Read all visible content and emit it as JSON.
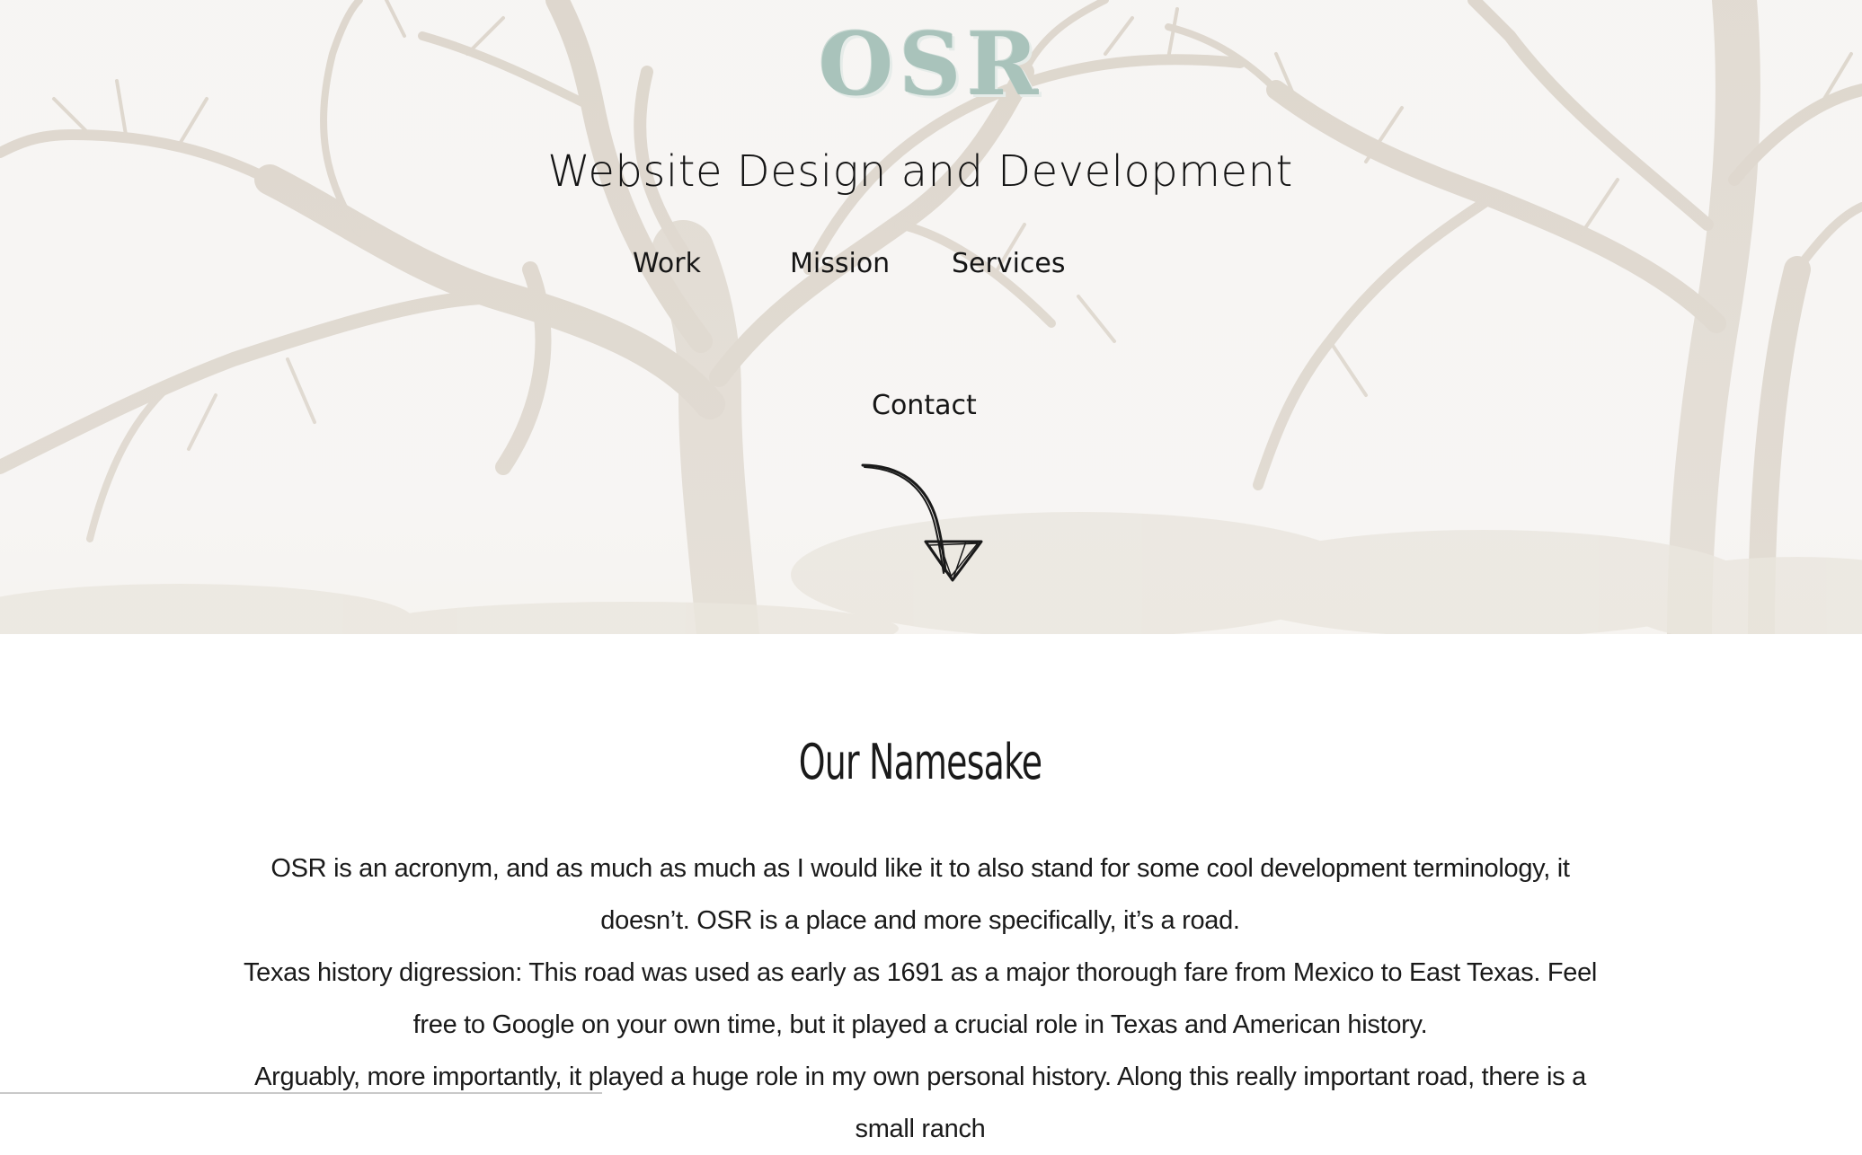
{
  "logo": "OSR",
  "tagline": "Website Design and Development",
  "nav": {
    "work": "Work",
    "mission": "Mission",
    "services": "Services",
    "contact": "Contact"
  },
  "section": {
    "title": "Our Namesake",
    "paragraphs": [
      "OSR is an acronym, and as much as much as I would like it to also stand for some cool development terminology, it doesn’t. OSR is a place and more specifically, it’s a road.",
      "Texas history digression: This road was used as early as 1691 as a major thorough fare from Mexico to East Texas. Feel free to Google on your own time, but it played a crucial role in Texas and American history.",
      "Arguably, more importantly, it played a huge role in my own personal history. Along this really important road, there is a small ranch"
    ]
  },
  "colors": {
    "logo": "#a9c3bb",
    "text": "#1a1a1a",
    "hero_background": "#f6f4f2"
  },
  "icons": {
    "scroll_arrow": "hand-drawn-down-arrow-icon"
  }
}
